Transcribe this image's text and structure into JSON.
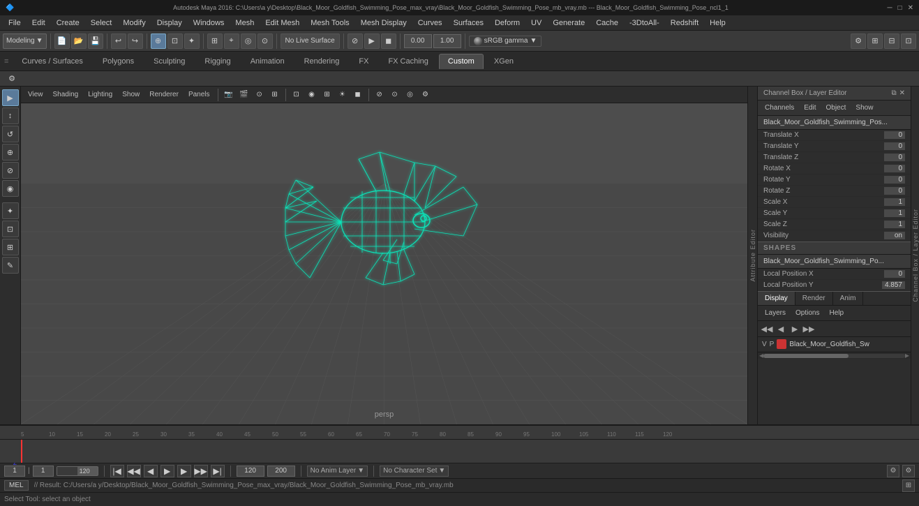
{
  "titlebar": {
    "title": "Autodesk Maya 2016: C:\\Users\\a y\\Desktop\\Black_Moor_Goldfish_Swimming_Pose_max_vray\\Black_Moor_Goldfish_Swimming_Pose_mb_vray.mb  ---  Black_Moor_Goldfish_Swimming_Pose_ncl1_1",
    "minimize": "─",
    "maximize": "□",
    "close": "✕"
  },
  "menubar": {
    "items": [
      "File",
      "Edit",
      "Create",
      "Select",
      "Modify",
      "Display",
      "Windows",
      "Mesh",
      "Edit Mesh",
      "Mesh Tools",
      "Mesh Display",
      "Curves",
      "Surfaces",
      "Deform",
      "UV",
      "Generate",
      "Cache",
      "-3DtoAll-",
      "Redshift",
      "Help"
    ]
  },
  "toolbar1": {
    "mode_label": "Modeling",
    "no_live_surface": "No Live Surface",
    "field1": "0.00",
    "field2": "1.00",
    "gamma": "sRGB gamma"
  },
  "tabs": {
    "items": [
      "Curves / Surfaces",
      "Polygons",
      "Sculpting",
      "Rigging",
      "Animation",
      "Rendering",
      "FX",
      "FX Caching",
      "Custom",
      "XGen"
    ]
  },
  "viewport": {
    "menu_items": [
      "View",
      "Shading",
      "Lighting",
      "Show",
      "Renderer",
      "Panels"
    ],
    "camera": "persp"
  },
  "left_toolbar": {
    "tools": [
      "▶",
      "↕",
      "↺",
      "⊕",
      "◉",
      "✦",
      "⊡",
      "⊞"
    ]
  },
  "channel_box": {
    "header": "Channel Box / Layer Editor",
    "menus": [
      "Channels",
      "Edit",
      "Object",
      "Show"
    ],
    "object_name": "Black_Moor_Goldfish_Swimming_Pos...",
    "channels": [
      {
        "name": "Translate X",
        "value": "0"
      },
      {
        "name": "Translate Y",
        "value": "0"
      },
      {
        "name": "Translate Z",
        "value": "0"
      },
      {
        "name": "Rotate X",
        "value": "0"
      },
      {
        "name": "Rotate Y",
        "value": "0"
      },
      {
        "name": "Rotate Z",
        "value": "0"
      },
      {
        "name": "Scale X",
        "value": "1"
      },
      {
        "name": "Scale Y",
        "value": "1"
      },
      {
        "name": "Scale Z",
        "value": "1"
      },
      {
        "name": "Visibility",
        "value": "on"
      }
    ],
    "shapes_header": "SHAPES",
    "shapes_object": "Black_Moor_Goldfish_Swimming_Po...",
    "local_pos": [
      {
        "name": "Local Position X",
        "value": "0"
      },
      {
        "name": "Local Position Y",
        "value": "4.857"
      }
    ]
  },
  "display_tabs": {
    "items": [
      "Display",
      "Render",
      "Anim"
    ],
    "active": "Display"
  },
  "layer_menus": [
    "Layers",
    "Options",
    "Help"
  ],
  "layer_icons": [
    "◀◀",
    "◀",
    "▶",
    "▶▶"
  ],
  "layer_item": {
    "v": "V",
    "p": "P",
    "color": "#cc3333",
    "name": "Black_Moor_Goldfish_Sw"
  },
  "attr_editor_tab": "Attribute Editor",
  "channel_side_tab": "Channel Box / Layer Editor",
  "timeline": {
    "ticks": [
      "5",
      "10",
      "15",
      "20",
      "25",
      "30",
      "35",
      "40",
      "45",
      "50",
      "55",
      "60",
      "65",
      "70",
      "75",
      "80",
      "85",
      "90",
      "95",
      "100",
      "105",
      "110",
      "115",
      "120"
    ]
  },
  "bottom_bar": {
    "frame1": "1",
    "frame2": "1",
    "frame3": "1",
    "end_frame": "120",
    "max_frame": "120",
    "out_frame": "200",
    "anim_layer": "No Anim Layer",
    "char_set": "No Character Set"
  },
  "status_bar": {
    "mel_label": "MEL",
    "result_text": "// Result: C:/Users/a y/Desktop/Black_Moor_Goldfish_Swimming_Pose_max_vray/Black_Moor_Goldfish_Swimming_Pose_mb_vray.mb",
    "status_text": "Select Tool: select an object"
  }
}
